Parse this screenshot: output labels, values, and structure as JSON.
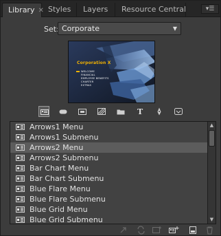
{
  "tabs": [
    {
      "label": "Library",
      "active": true,
      "closable": true
    },
    {
      "label": "Styles"
    },
    {
      "label": "Layers"
    },
    {
      "label": "Resource Central"
    }
  ],
  "panel_menu_icon": "panel-menu-icon",
  "set": {
    "label": "Set:",
    "value": "Corporate"
  },
  "preview": {
    "title": "Corporation X",
    "items": [
      "WELCOME",
      "FINANCIAL",
      "EMPLOYEE BENEFITS",
      "CHARTER",
      "EXTRAS"
    ]
  },
  "filters": [
    {
      "icon": "menu-filter-icon",
      "selected": true
    },
    {
      "icon": "button-filter-icon"
    },
    {
      "icon": "frame-filter-icon"
    },
    {
      "icon": "background-filter-icon"
    },
    {
      "icon": "folder-filter-icon"
    },
    {
      "icon": "text-filter-icon"
    },
    {
      "icon": "pen-filter-icon"
    },
    {
      "icon": "badge-filter-icon"
    }
  ],
  "list": {
    "items": [
      {
        "label": "Arrows1 Menu"
      },
      {
        "label": "Arrows1 Submenu"
      },
      {
        "label": "Arrows2 Menu",
        "selected": true
      },
      {
        "label": "Arrows2 Submenu"
      },
      {
        "label": "Bar Chart Menu"
      },
      {
        "label": "Bar Chart Submenu"
      },
      {
        "label": "Blue Flare Menu"
      },
      {
        "label": "Blue Flare Submenu"
      },
      {
        "label": "Blue Grid Menu"
      },
      {
        "label": "Blue Grid Submenu"
      }
    ]
  },
  "bottom_toolbar": [
    "apply-icon",
    "replace-icon",
    "add-icon",
    "new-menu-icon",
    "place-icon",
    "delete-icon"
  ],
  "colors": {
    "panel_bg": "#3c3c3c",
    "tabbar_bg": "#262626",
    "list_bg": "#424242",
    "selected_row": "#5c5c5c",
    "preview_title": "#f5b400"
  }
}
